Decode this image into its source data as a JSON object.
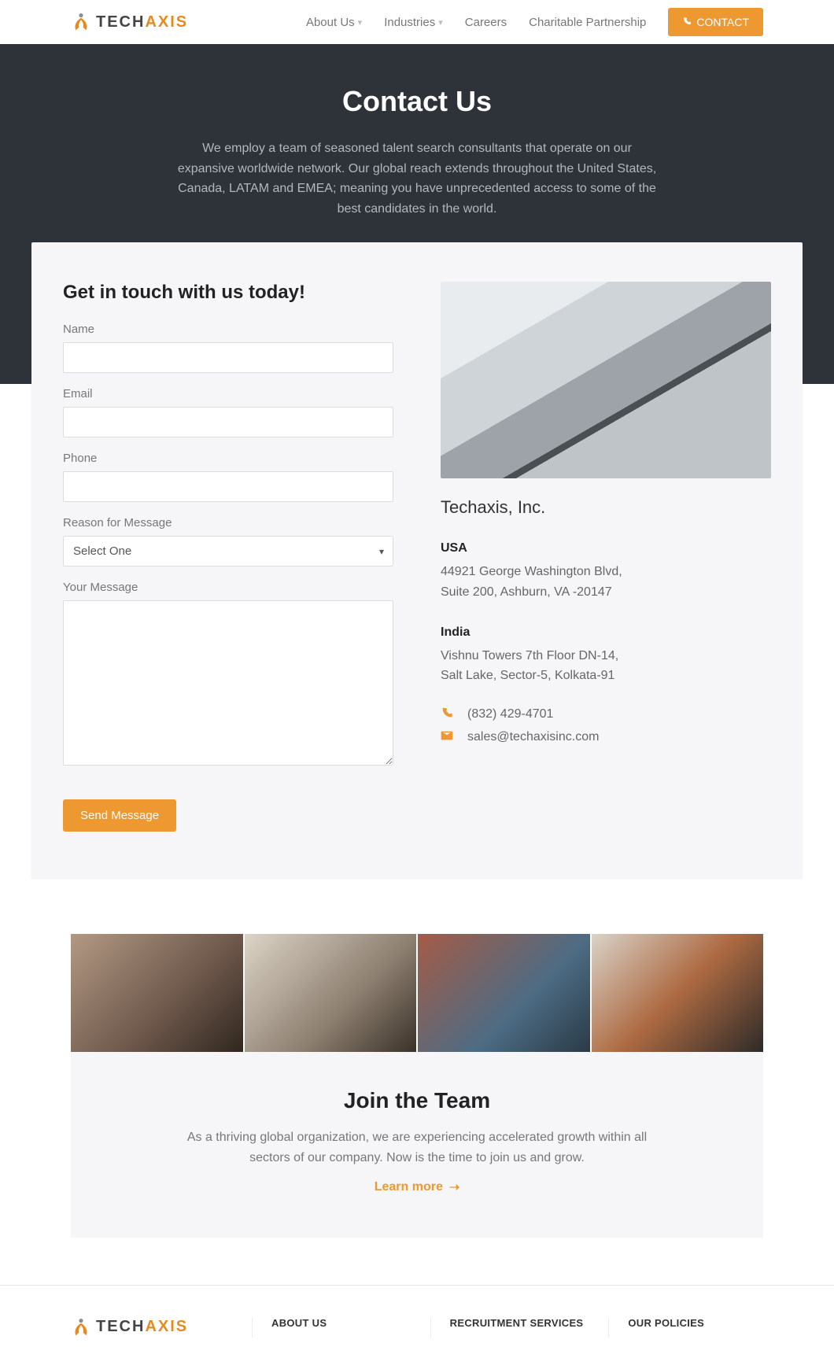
{
  "nav": {
    "items": [
      {
        "label": "About Us",
        "dropdown": true
      },
      {
        "label": "Industries",
        "dropdown": true
      },
      {
        "label": "Careers",
        "dropdown": false
      },
      {
        "label": "Charitable Partnership",
        "dropdown": false
      }
    ],
    "contact_btn": "CONTACT",
    "logo_text_a": "TECH",
    "logo_text_b": "AXIS"
  },
  "hero": {
    "title": "Contact Us",
    "body": "We employ a team of seasoned talent search consultants that operate on our expansive worldwide network. Our global reach extends throughout the United States, Canada, LATAM and EMEA; meaning you have unprecedented access to some of the best candidates in the world."
  },
  "form": {
    "heading": "Get in touch with us today!",
    "name_label": "Name",
    "email_label": "Email",
    "phone_label": "Phone",
    "reason_label": "Reason for Message",
    "reason_selected": "Select One",
    "message_label": "Your Message",
    "submit": "Send Message"
  },
  "company": {
    "name": "Techaxis, Inc.",
    "usa_title": "USA",
    "usa_line1": "44921 George Washington Blvd,",
    "usa_line2": "Suite 200, Ashburn, VA -20147",
    "india_title": "India",
    "india_line1": "Vishnu Towers 7th Floor DN-14,",
    "india_line2": "Salt Lake, Sector-5, Kolkata-91",
    "phone": "(832) 429-4701",
    "email": "sales@techaxisinc.com"
  },
  "join": {
    "title": "Join the Team",
    "body": "As a thriving global organization, we are experiencing accelerated growth within all sectors of our company. Now is the time to join us and grow.",
    "link": "Learn more"
  },
  "footer": {
    "col1": "ABOUT US",
    "col2": "RECRUITMENT SERVICES",
    "col3": "OUR POLICIES"
  },
  "colors": {
    "accent": "#ed9830",
    "dark": "#2e333a"
  }
}
